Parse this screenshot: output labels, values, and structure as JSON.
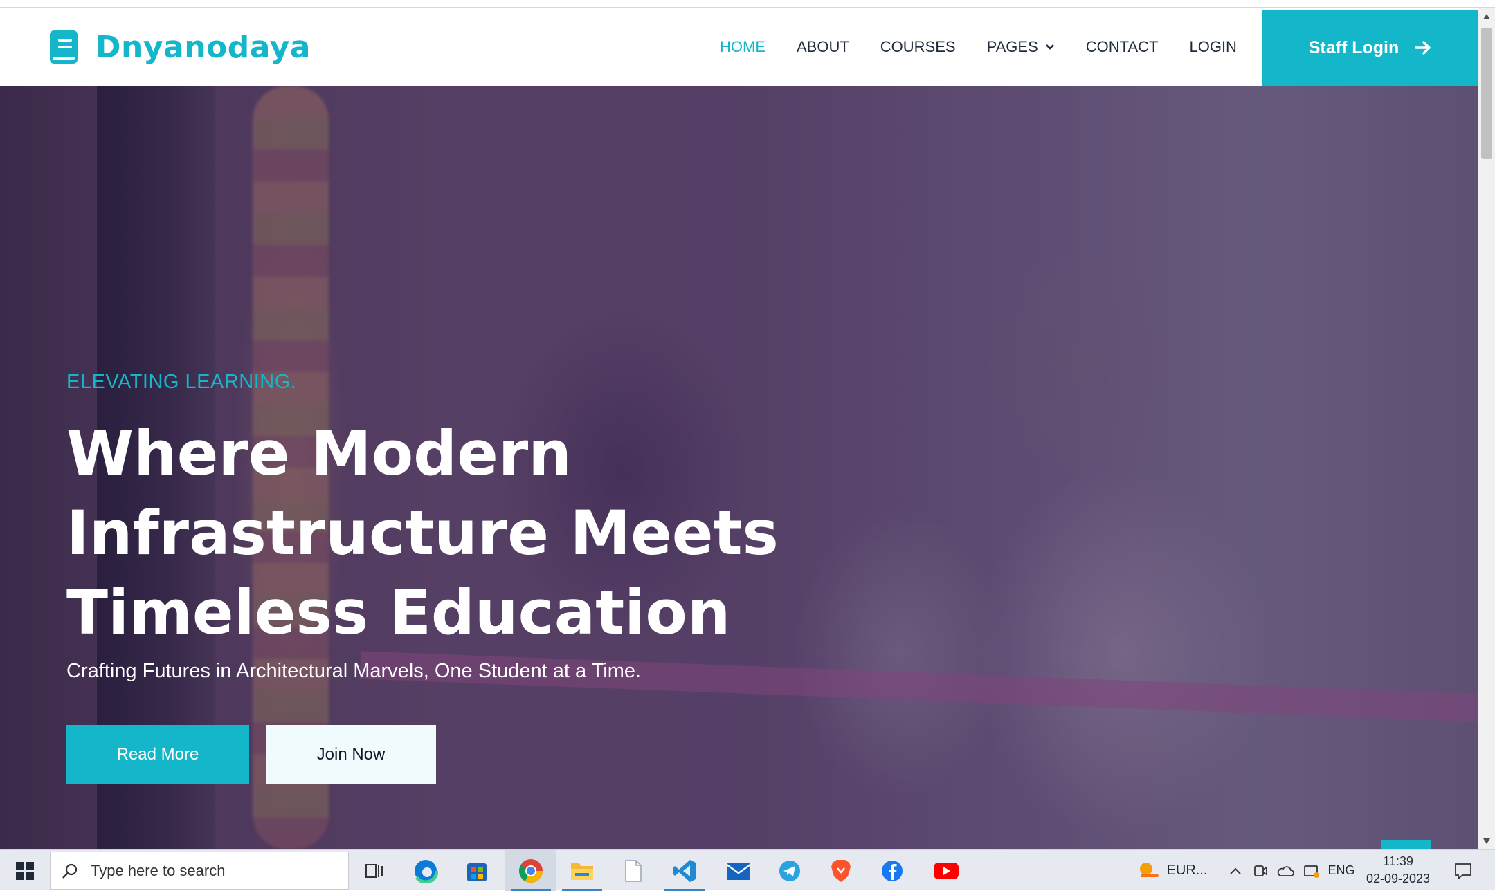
{
  "brand": {
    "name": "Dnyanodaya",
    "accent": "#14b6c9"
  },
  "nav": {
    "items": [
      {
        "label": "HOME",
        "active": true
      },
      {
        "label": "ABOUT",
        "active": false
      },
      {
        "label": "COURSES",
        "active": false
      },
      {
        "label": "PAGES",
        "active": false,
        "has_dropdown": true
      },
      {
        "label": "CONTACT",
        "active": false
      },
      {
        "label": "LOGIN",
        "active": false
      }
    ],
    "staff_button": "Staff Login"
  },
  "hero": {
    "eyebrow": "ELEVATING LEARNING.",
    "headline": "Where Modern Infrastructure Meets Timeless Education",
    "subline": "Crafting Futures in Architectural Marvels, One Student at a Time.",
    "primary_button": "Read More",
    "secondary_button": "Join Now"
  },
  "taskbar": {
    "search_placeholder": "Type here to search",
    "apps": [
      "task-view",
      "edge",
      "microsoft-store",
      "chrome",
      "file-explorer",
      "notepad",
      "vscode",
      "mail",
      "telegram",
      "brave",
      "facebook",
      "youtube"
    ],
    "weather_text": "EUR...",
    "language": "ENG",
    "time": "11:39",
    "date": "02-09-2023"
  }
}
